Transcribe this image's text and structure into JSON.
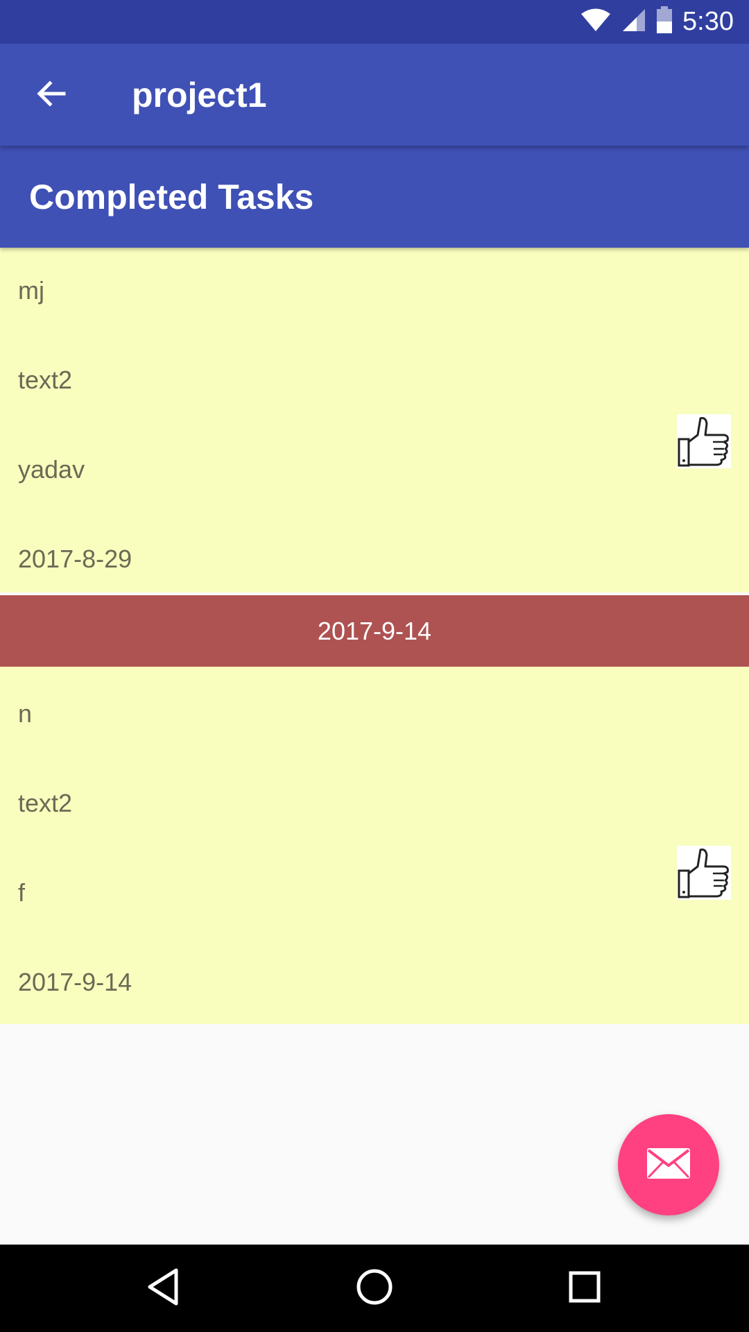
{
  "status_bar": {
    "time": "5:30",
    "icons": [
      "wifi-icon",
      "signal-icon",
      "battery-icon"
    ]
  },
  "toolbar": {
    "title": "project1",
    "back_icon": "arrow-back-icon"
  },
  "section": {
    "title": "Completed Tasks"
  },
  "tasks": [
    {
      "lines": [
        "mj",
        "text2",
        "yadav",
        "2017-8-29"
      ],
      "icon": "thumbs-up-icon"
    },
    {
      "lines": [
        "n",
        "text2",
        "f",
        "2017-9-14"
      ],
      "icon": "thumbs-up-icon"
    }
  ],
  "divider": {
    "date": "2017-9-14"
  },
  "fab": {
    "icon": "mail-icon"
  },
  "nav": {
    "buttons": [
      "back-triangle-icon",
      "home-circle-icon",
      "recents-square-icon"
    ]
  },
  "colors": {
    "primary": "#3f51b5",
    "primary_dark": "#303f9f",
    "card_bg": "#f9fdbd",
    "divider_bg": "#ae5252",
    "accent": "#ff4081"
  }
}
